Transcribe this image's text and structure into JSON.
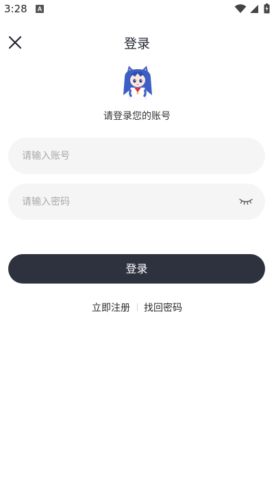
{
  "status_bar": {
    "time": "3:28",
    "notification_letter": "A",
    "icons": [
      "wifi-icon",
      "cell-signal-icon",
      "battery-icon"
    ]
  },
  "header": {
    "title": "登录",
    "close_icon": "close-icon"
  },
  "subtitle": "请登录您的账号",
  "form": {
    "account_placeholder": "请输入账号",
    "account_value": "",
    "password_placeholder": "请输入密码",
    "password_value": "",
    "eye_icon": "eye-closed-icon"
  },
  "login_button_label": "登录",
  "links": {
    "register": "立即注册",
    "forgot_password": "找回密码"
  },
  "colors": {
    "button_bg": "#2e323f",
    "field_bg": "#f5f5f5",
    "placeholder": "#a9a9ad",
    "avatar_hair": "#3d5fc4"
  }
}
